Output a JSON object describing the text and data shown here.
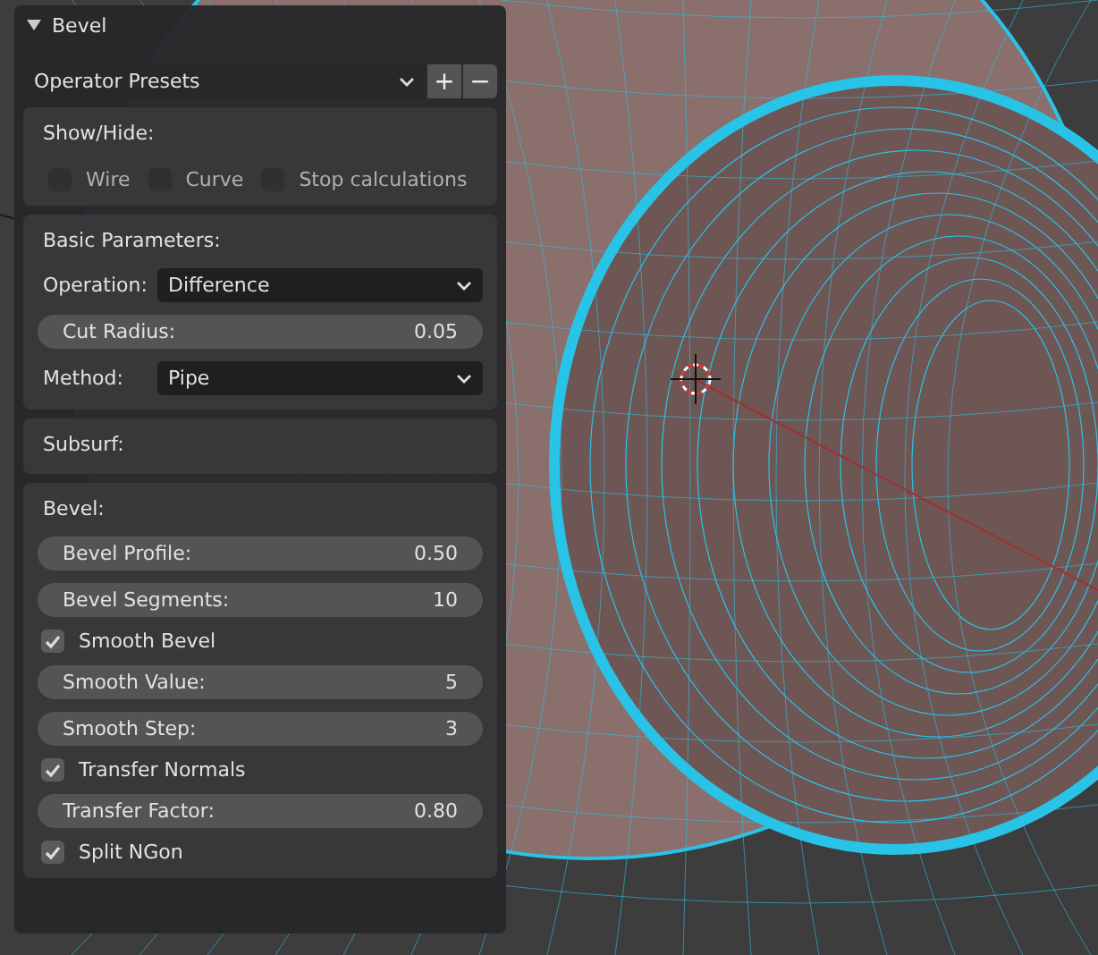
{
  "panel": {
    "title": "Bevel",
    "expanded": true
  },
  "presets": {
    "label": "Operator Presets",
    "buttons": [
      "+",
      "−"
    ]
  },
  "sections": [
    {
      "title": "Show/Hide:",
      "items": [
        {
          "kind": "checkrow",
          "checks": [
            {
              "label": "Wire",
              "checked": false
            },
            {
              "label": "Curve",
              "checked": false
            },
            {
              "label": "Stop calculations",
              "checked": false
            }
          ]
        }
      ]
    },
    {
      "title": "Basic Parameters:",
      "items": [
        {
          "kind": "dropdown",
          "label": "Operation:",
          "value": "Difference"
        },
        {
          "kind": "number",
          "label": "Cut Radius:",
          "value": "0.05"
        },
        {
          "kind": "dropdown",
          "label": "Method:",
          "value": "Pipe"
        }
      ]
    },
    {
      "title": "Subsurf:"
    },
    {
      "title": "Bevel:",
      "items": [
        {
          "kind": "number",
          "label": "Bevel Profile:",
          "value": "0.50"
        },
        {
          "kind": "number",
          "label": "Bevel Segments:",
          "value": "10"
        },
        {
          "kind": "checkbox",
          "label": "Smooth Bevel",
          "checked": true
        },
        {
          "kind": "number",
          "label": "Smooth Value:",
          "value": "5"
        },
        {
          "kind": "number",
          "label": "Smooth Step:",
          "value": "3"
        },
        {
          "kind": "checkbox",
          "label": "Transfer Normals",
          "checked": true
        },
        {
          "kind": "number",
          "label": "Transfer Factor:",
          "value": "0.80"
        },
        {
          "kind": "checkbox",
          "label": "Split NGon",
          "checked": true
        }
      ]
    }
  ]
}
